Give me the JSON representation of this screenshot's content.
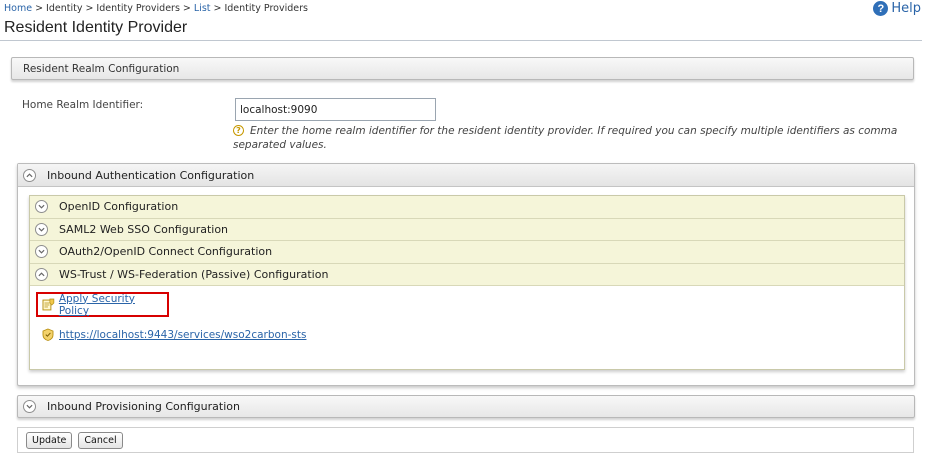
{
  "breadcrumb": {
    "items": [
      "Home",
      "Identity",
      "Identity Providers",
      "List",
      "Identity Providers"
    ],
    "separator": ">"
  },
  "help": {
    "label": "Help"
  },
  "page": {
    "title": "Resident Identity Provider"
  },
  "realm_section": {
    "title": "Resident Realm Configuration"
  },
  "home_realm": {
    "label": "Home Realm Identifier:",
    "value": "localhost:9090",
    "hint": "Enter the home realm identifier for the resident identity provider. If required you can specify multiple identifiers as comma separated values."
  },
  "inbound_auth": {
    "title": "Inbound Authentication Configuration",
    "sections": [
      {
        "label": "OpenID Configuration",
        "expanded": false
      },
      {
        "label": "SAML2 Web SSO Configuration",
        "expanded": false
      },
      {
        "label": "OAuth2/OpenID Connect Configuration",
        "expanded": false
      },
      {
        "label": "WS-Trust / WS-Federation (Passive) Configuration",
        "expanded": true
      }
    ],
    "ws_trust": {
      "policy_link": "Apply Security Policy",
      "sts_url": "https://localhost:9443/services/wso2carbon-sts"
    }
  },
  "inbound_provisioning": {
    "title": "Inbound Provisioning Configuration"
  },
  "buttons": {
    "update": "Update",
    "cancel": "Cancel"
  },
  "colors": {
    "link": "#2a64a8",
    "highlight_border": "#d70000",
    "section_row_bg": "#f5f5d9"
  }
}
